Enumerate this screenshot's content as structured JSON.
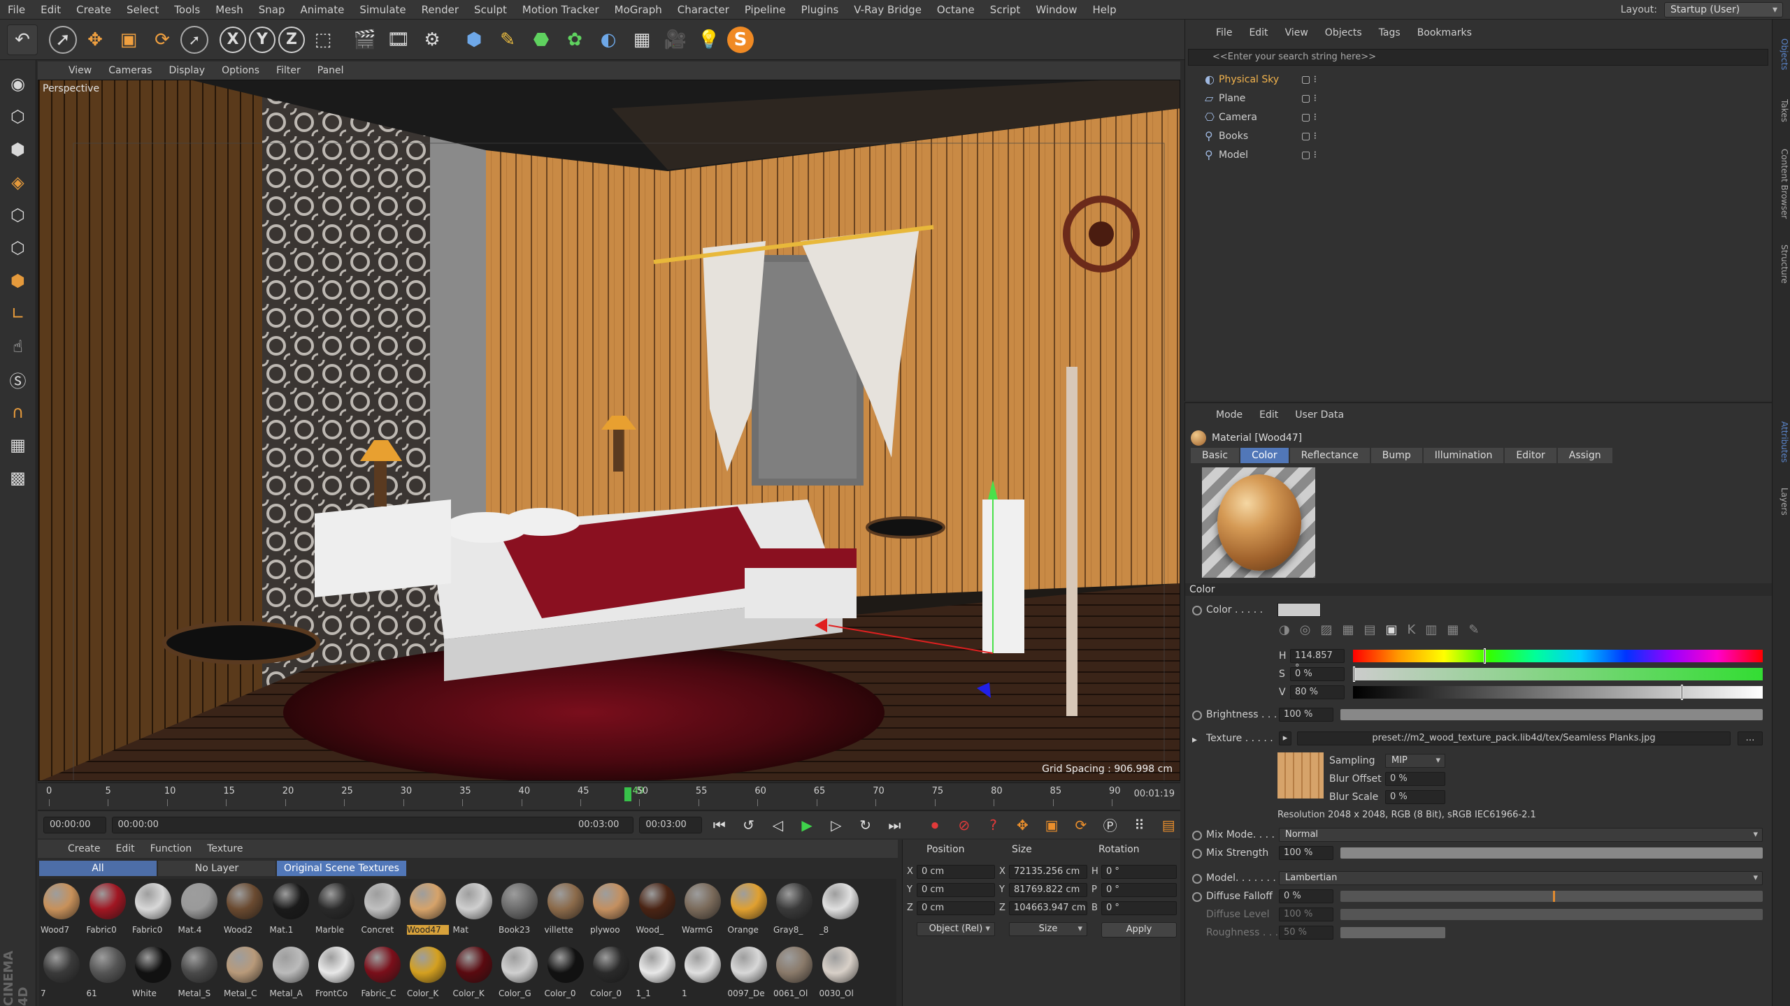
{
  "menubar": {
    "items": [
      "File",
      "Edit",
      "Create",
      "Select",
      "Tools",
      "Mesh",
      "Snap",
      "Animate",
      "Simulate",
      "Render",
      "Sculpt",
      "Motion Tracker",
      "MoGraph",
      "Character",
      "Pipeline",
      "Plugins",
      "V-Ray Bridge",
      "Octane",
      "Script",
      "Window",
      "Help"
    ],
    "layout_label": "Layout:",
    "layout_value": "Startup (User)"
  },
  "viewport": {
    "menu": [
      "View",
      "Cameras",
      "Display",
      "Options",
      "Filter",
      "Panel"
    ],
    "camera_label": "Perspective",
    "grid_spacing": "Grid Spacing : 906.998 cm"
  },
  "timeline": {
    "ticks": [
      "0",
      "5",
      "10",
      "15",
      "20",
      "25",
      "30",
      "35",
      "40",
      "45",
      "50",
      "55",
      "60",
      "65",
      "70",
      "75",
      "80",
      "85",
      "90"
    ],
    "current_frame": "49",
    "current_frame_value": 49,
    "readout": "00:01:19"
  },
  "transport": {
    "start_time": "00:00:00",
    "slider_start": "00:00:00",
    "slider_end": "00:03:00",
    "end_time": "00:03:00"
  },
  "material_manager": {
    "menu": [
      "Create",
      "Edit",
      "Function",
      "Texture"
    ],
    "filters": [
      "All",
      "No Layer",
      "Original Scene Textures"
    ],
    "materials": [
      {
        "name": "Wood7",
        "color": "#c8915a"
      },
      {
        "name": "Fabric0",
        "color": "#a01622"
      },
      {
        "name": "Fabric0",
        "color": "#d8d8d8"
      },
      {
        "name": "Mat.4",
        "color": "#9a9a9a"
      },
      {
        "name": "Wood2",
        "color": "#6a4a30"
      },
      {
        "name": "Mat.1",
        "color": "#1a1a1a"
      },
      {
        "name": "Marble",
        "color": "#2a2a2a"
      },
      {
        "name": "Concret",
        "color": "#c0c0c0"
      },
      {
        "name": "Wood47",
        "color": "#d6a36a",
        "selected": true
      },
      {
        "name": "Mat",
        "color": "#cfcfcf"
      },
      {
        "name": "Book23",
        "color": "#6b6b6b"
      },
      {
        "name": "villette",
        "color": "#8b6a4a"
      },
      {
        "name": "plywoo",
        "color": "#c49060"
      },
      {
        "name": "Wood_",
        "color": "#4a2414"
      },
      {
        "name": "WarmG",
        "color": "#7a6a5a"
      },
      {
        "name": "Orange",
        "color": "#e0a030"
      },
      {
        "name": "Gray8_",
        "color": "#3a3a3a"
      },
      {
        "name": "_8",
        "color": "#e0e0e0"
      },
      {
        "name": "7",
        "color": "#3a3a3a"
      },
      {
        "name": "61",
        "color": "#555"
      },
      {
        "name": "White",
        "color": "#111"
      },
      {
        "name": "Metal_S",
        "color": "#4a4a4a"
      },
      {
        "name": "Metal_C",
        "color": "#b89a7a"
      },
      {
        "name": "Metal_A",
        "color": "#bbbbbb"
      },
      {
        "name": "FrontCo",
        "color": "#e8e8e8"
      },
      {
        "name": "Fabric_C",
        "color": "#7a0f1a"
      },
      {
        "name": "Color_K",
        "color": "#d4a020"
      },
      {
        "name": "Color_K",
        "color": "#5a0a10"
      },
      {
        "name": "Color_G",
        "color": "#d0d0d0"
      },
      {
        "name": "Color_0",
        "color": "#111"
      },
      {
        "name": "Color_0",
        "color": "#2a2a2a"
      },
      {
        "name": "1_1",
        "color": "#e8e8e8"
      },
      {
        "name": "1",
        "color": "#e0e0e0"
      },
      {
        "name": "0097_De",
        "color": "#d8d8d8"
      },
      {
        "name": "0061_Ol",
        "color": "#8a7a6a"
      },
      {
        "name": "0030_Ol",
        "color": "#d8d0c8"
      }
    ]
  },
  "coordinates": {
    "headers": [
      "Position",
      "Size",
      "Rotation"
    ],
    "rows": [
      {
        "axis": "X",
        "pos": "0 cm",
        "size_axis": "X",
        "size": "72135.256 cm",
        "rot_axis": "H",
        "rot": "0 °"
      },
      {
        "axis": "Y",
        "pos": "0 cm",
        "size_axis": "Y",
        "size": "81769.822 cm",
        "rot_axis": "P",
        "rot": "0 °"
      },
      {
        "axis": "Z",
        "pos": "0 cm",
        "size_axis": "Z",
        "size": "104663.947 cm",
        "rot_axis": "B",
        "rot": "0 °"
      }
    ],
    "mode": "Object (Rel)",
    "size_mode": "Size",
    "apply": "Apply"
  },
  "object_manager": {
    "menu": [
      "File",
      "Edit",
      "View",
      "Objects",
      "Tags",
      "Bookmarks"
    ],
    "search_placeholder": "<<Enter your search string here>>",
    "objects": [
      {
        "name": "Physical Sky",
        "icon": "sky-icon",
        "selected": true
      },
      {
        "name": "Plane",
        "icon": "plane-icon"
      },
      {
        "name": "Camera",
        "icon": "camera-icon"
      },
      {
        "name": "Books",
        "icon": "null-icon"
      },
      {
        "name": "Model",
        "icon": "null-icon"
      }
    ]
  },
  "attributes": {
    "menu": [
      "Mode",
      "Edit",
      "User Data"
    ],
    "title": "Material [Wood47]",
    "tabs": [
      "Basic",
      "Color",
      "Reflectance",
      "Bump",
      "Illumination",
      "Editor",
      "Assign"
    ],
    "active_tab": "Color",
    "section": "Color",
    "color_label": "Color . . . . .",
    "h": "114.857 °",
    "h_fraction": 0.319,
    "s": "0 %",
    "v": "80 %",
    "v_fraction": 0.8,
    "brightness_label": "Brightness . . .",
    "brightness": "100 %",
    "texture_label": "Texture . . . . .",
    "texture_path": "preset://m2_wood_texture_pack.lib4d/tex/Seamless Planks.jpg",
    "sampling_label": "Sampling",
    "sampling": "MIP",
    "blur_offset_label": "Blur Offset",
    "blur_offset": "0 %",
    "blur_scale_label": "Blur Scale",
    "blur_scale": "0 %",
    "resolution": "Resolution 2048 x 2048, RGB (8 Bit), sRGB IEC61966-2.1",
    "mix_mode_label": "Mix Mode. . . .",
    "mix_mode": "Normal",
    "mix_strength_label": "Mix Strength",
    "mix_strength": "100 %",
    "model_label": "Model. . . . . . .",
    "model": "Lambertian",
    "diffuse_falloff_label": "Diffuse Falloff",
    "diffuse_falloff": "0 %",
    "diffuse_level_label": "Diffuse Level",
    "diffuse_level": "100 %",
    "roughness_label": "Roughness . . .",
    "roughness": "50 %"
  },
  "side_tabs": [
    "Objects",
    "Takes",
    "Content Browser",
    "Structure",
    "Attributes",
    "Layers"
  ],
  "brand": "CINEMA 4D"
}
